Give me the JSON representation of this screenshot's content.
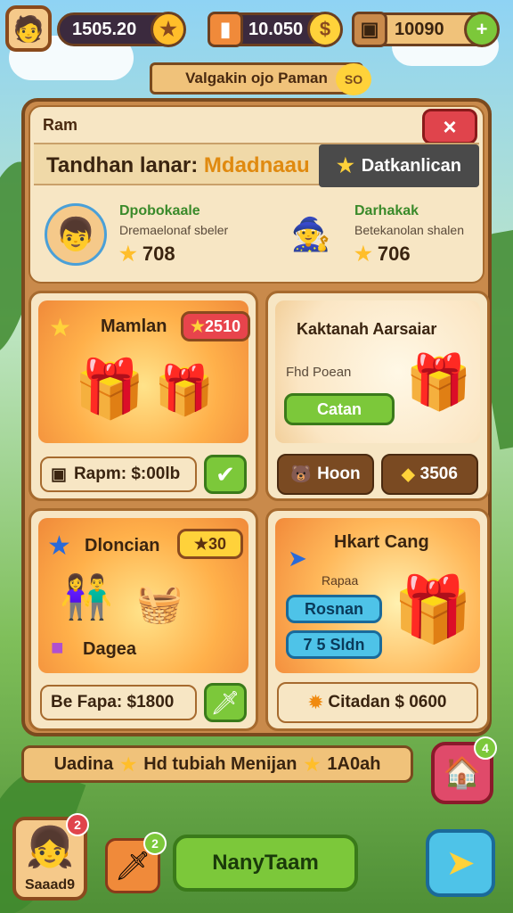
{
  "colors": {
    "accent": "#e08a10",
    "positive": "#7cc83a",
    "danger": "#e0444c",
    "info": "#4ec3e8",
    "wood": "#c98a4b"
  },
  "topbar": {
    "avatar_icon": "player-avatar-icon",
    "resource1": {
      "value": "1505.20",
      "icon": "star-icon"
    },
    "resource2": {
      "value": "10.050",
      "icon": "coin-icon"
    },
    "resource3": {
      "value": "10090",
      "icon": "plus-icon"
    }
  },
  "banner": {
    "text": "Valgakin ojo Paman",
    "badge": "SO"
  },
  "panel": {
    "label": "Ram",
    "close_label": "×",
    "title": "Tandhan lanar:",
    "title_highlight": "Mdadnaau",
    "tab_label": "Datkanlican",
    "players": [
      {
        "name": "Dpobokaale",
        "subtitle": "Dremaelonaf sbeler",
        "score": "708"
      },
      {
        "name": "Darhakak",
        "subtitle": "Betekanolan shalen",
        "score": "706"
      }
    ]
  },
  "cards": {
    "card1": {
      "title": "Mamlan",
      "tag": "2510",
      "cost": "Rapm: $:00lb"
    },
    "card2": {
      "title": "Kaktanah Aarsaiar",
      "subtitle": "Fhd Poean",
      "button": "Catan",
      "chip1": "Hoon",
      "chip2": "3506"
    },
    "card3": {
      "title": "Dloncian",
      "tag": "30",
      "item": "Dagea",
      "cost": "Be Fapa: $1800"
    },
    "card4": {
      "title": "Hkart Cang",
      "subtitle": "Rapaa",
      "button1": "Rosnan",
      "button2": "7 5 Sldn",
      "cost": "Citadan $ 0600"
    }
  },
  "wide_bar": {
    "left": "Uadina",
    "middle": "Hd tubiah Menijan",
    "right": "1A0ah"
  },
  "bottom": {
    "avatar_label": "Saaad9",
    "avatar_badge": "2",
    "sword_badge": "2",
    "main_button": "NanyTaam",
    "house_badge": "4"
  }
}
